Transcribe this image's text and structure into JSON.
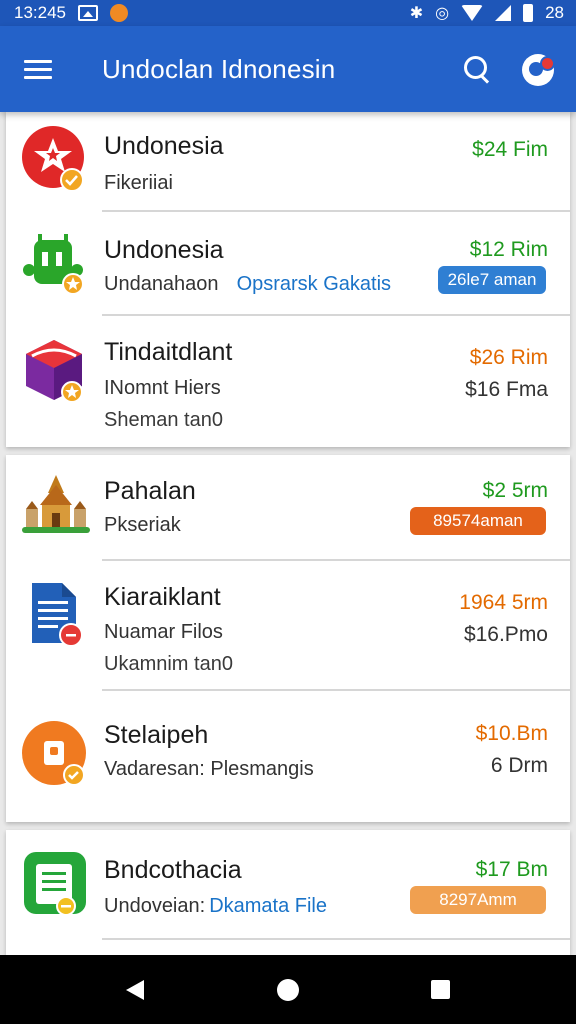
{
  "status": {
    "time": "13:245",
    "right_text": "28"
  },
  "app_bar": {
    "title": "Undoclan Idnonesin"
  },
  "items": [
    {
      "title": "Undonesia",
      "subtitle": "Fikeriiai",
      "price": "$24 Fim",
      "price_color": "#1f9a1f"
    },
    {
      "title": "Undonesia",
      "subtitle": "Undanahaon",
      "link": "Opsrarsk Gakatis",
      "price": "$12 Rim",
      "price_color": "#1f9a1f",
      "pill": "26le7 aman",
      "pill_color": "#2f7fd3"
    },
    {
      "title": "Tindaitdlant",
      "subtitle": "INomnt Hiers",
      "third": "Sheman tan0",
      "price": "$26 Rim",
      "price_color": "#e36a00",
      "price2": "$16 Fma"
    },
    {
      "title": "Pahalan",
      "subtitle": "Pkseriak",
      "price": "$2 5rm",
      "price_color": "#1f9a1f",
      "pill": "89574aman",
      "pill_color": "#e4621a"
    },
    {
      "title": "Kiaraiklant",
      "subtitle": "Nuamar Filos",
      "third": "Ukamnim tan0",
      "price": "1964 5rm",
      "price_color": "#e36a00",
      "price2": "$16.Pmo"
    },
    {
      "title": "Stelaipeh",
      "subtitle": "Vadaresan: Plesmangis",
      "price": "$10.Bm",
      "price_color": "#e36a00",
      "price2": "6 Drm"
    },
    {
      "title": "Bndcothacia",
      "subtitle": "Undoveian:",
      "link": "Dkamata File",
      "price": "$17 Bm",
      "price_color": "#1f9a1f",
      "pill": "8297Amm",
      "pill_color": "#f0a050"
    }
  ]
}
